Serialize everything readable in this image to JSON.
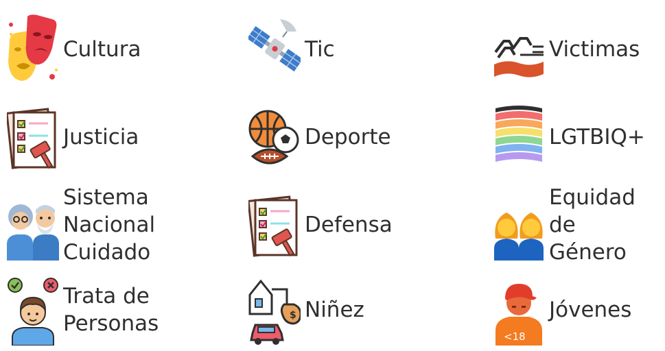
{
  "categories": [
    {
      "label": "Cultura",
      "icon": "theater-masks-icon"
    },
    {
      "label": "Tic",
      "icon": "satellite-icon"
    },
    {
      "label": "Victimas",
      "icon": "victims-icon"
    },
    {
      "label": "Justicia",
      "icon": "checklist-gavel-icon"
    },
    {
      "label": "Deporte",
      "icon": "sports-balls-icon"
    },
    {
      "label": "LGTBIQ+",
      "icon": "rainbow-flag-icon"
    },
    {
      "label_lines": [
        "Sistema Nacional",
        "Cuidado"
      ],
      "icon": "elderly-couple-icon"
    },
    {
      "label": "Defensa",
      "icon": "checklist-gavel-icon"
    },
    {
      "label_lines": [
        "Equidad de",
        "Género"
      ],
      "icon": "two-women-icon"
    },
    {
      "label_lines": [
        "Trata de",
        "Personas"
      ],
      "icon": "person-choice-icon"
    },
    {
      "label": "Niñez",
      "icon": "house-car-money-icon"
    },
    {
      "label": "Jóvenes",
      "icon": "youth-cap-icon"
    }
  ],
  "colors": {
    "text": "#2f2f2f",
    "mask_red": "#e53946",
    "mask_yellow": "#ffcb3d",
    "gavel": "#e0564e",
    "check_green": "#88c057",
    "hair_orange": "#f29c1f",
    "hoodie_orange": "#f47b20"
  }
}
